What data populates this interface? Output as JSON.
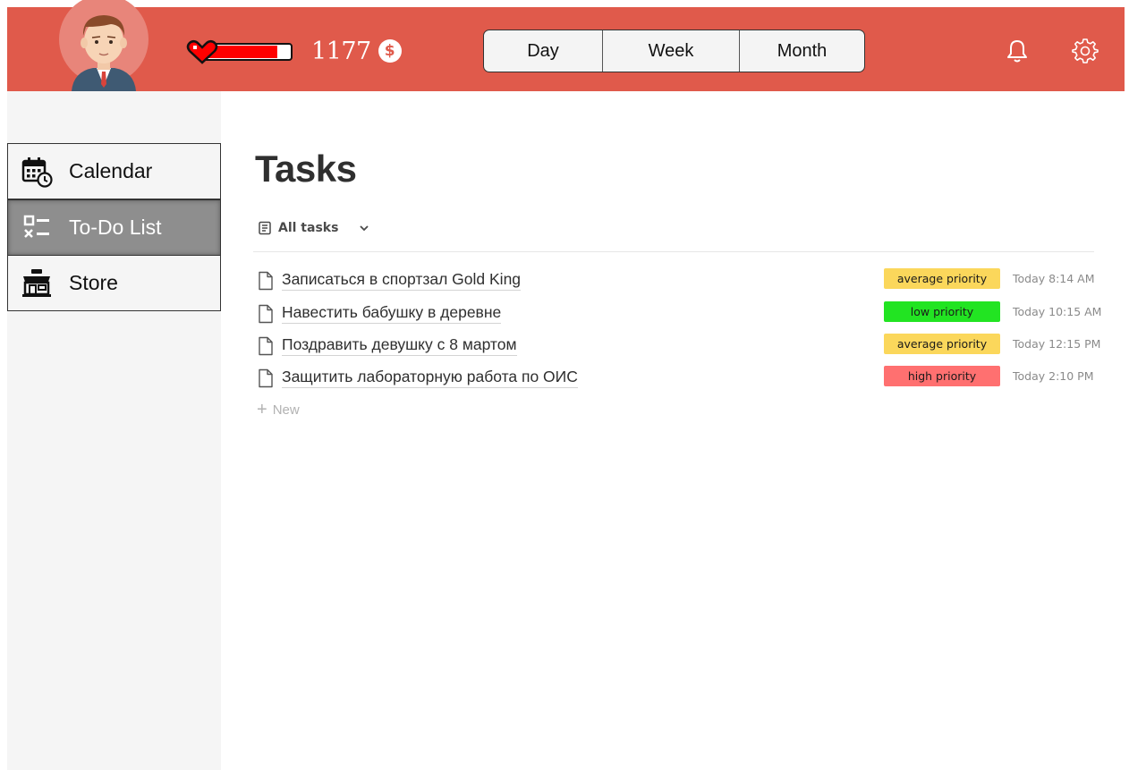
{
  "header": {
    "health_level": 0.85,
    "coins": "1177",
    "coin_symbol": "$",
    "range_tabs": [
      {
        "label": "Day"
      },
      {
        "label": "Week"
      },
      {
        "label": "Month"
      }
    ],
    "colors": {
      "bar": "#e05a4b",
      "health": "#ff0000"
    },
    "icons": [
      "user-avatar",
      "heart-icon",
      "coin-icon",
      "bell-icon",
      "gear-icon"
    ]
  },
  "sidebar": {
    "items": [
      {
        "label": "Calendar",
        "icon": "calendar-clock-icon",
        "active": false
      },
      {
        "label": "To-Do List",
        "icon": "checklist-icon",
        "active": true
      },
      {
        "label": "Store",
        "icon": "shop-icon",
        "active": false
      }
    ]
  },
  "main": {
    "title": "Tasks",
    "view": {
      "label": "All tasks",
      "icon": "list-doc-icon"
    },
    "tasks": [
      {
        "title": "Записаться в спортзал Gold King",
        "priority": "average priority",
        "priority_color": "#fbd75b",
        "time": "Today 8:14 AM"
      },
      {
        "title": "Навестить бабушку в деревне",
        "priority": "low priority",
        "priority_color": "#22e422",
        "time": "Today 10:15 AM"
      },
      {
        "title": "Поздравить девушку с 8 мартом",
        "priority": "average priority",
        "priority_color": "#fbd75b",
        "time": "Today 12:15 PM"
      },
      {
        "title": "Защитить лабораторную работа по ОИС",
        "priority": "high priority",
        "priority_color": "#ff7070",
        "time": "Today 2:10 PM"
      }
    ],
    "new_label": "New"
  }
}
